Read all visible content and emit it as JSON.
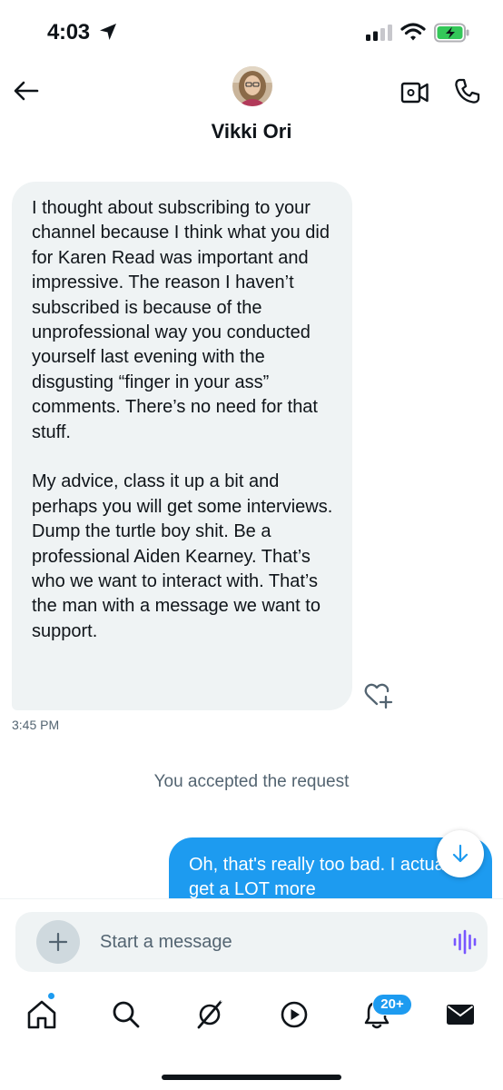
{
  "status_bar": {
    "time": "4:03"
  },
  "header": {
    "contact_name": "Vikki Ori"
  },
  "messages": {
    "incoming": {
      "paragraphs": [
        "I thought about subscribing to your channel because I think what you did for Karen Read was important and impressive. The reason I haven’t subscribed is because of the unprofessional way you conducted yourself last evening with the disgusting “finger in your ass” comments. There’s no need for that stuff.",
        "My advice, class it up a bit and perhaps you will get some interviews. Dump the turtle boy shit. Be a professional Aiden Kearney. That’s who we want to interact with. That’s the man with a message we want to support."
      ],
      "time": "3:45 PM"
    },
    "system_note": "You accepted the request",
    "outgoing": {
      "text": "Oh, that's really too bad. I actually get a LOT more"
    }
  },
  "composer": {
    "placeholder": "Start a message"
  },
  "nav": {
    "notifications_badge": "20+"
  },
  "colors": {
    "accent": "#1d9bf0",
    "incoming_bubble": "#eff3f4",
    "secondary_text": "#536471",
    "voice_icon": "#7856ff"
  }
}
